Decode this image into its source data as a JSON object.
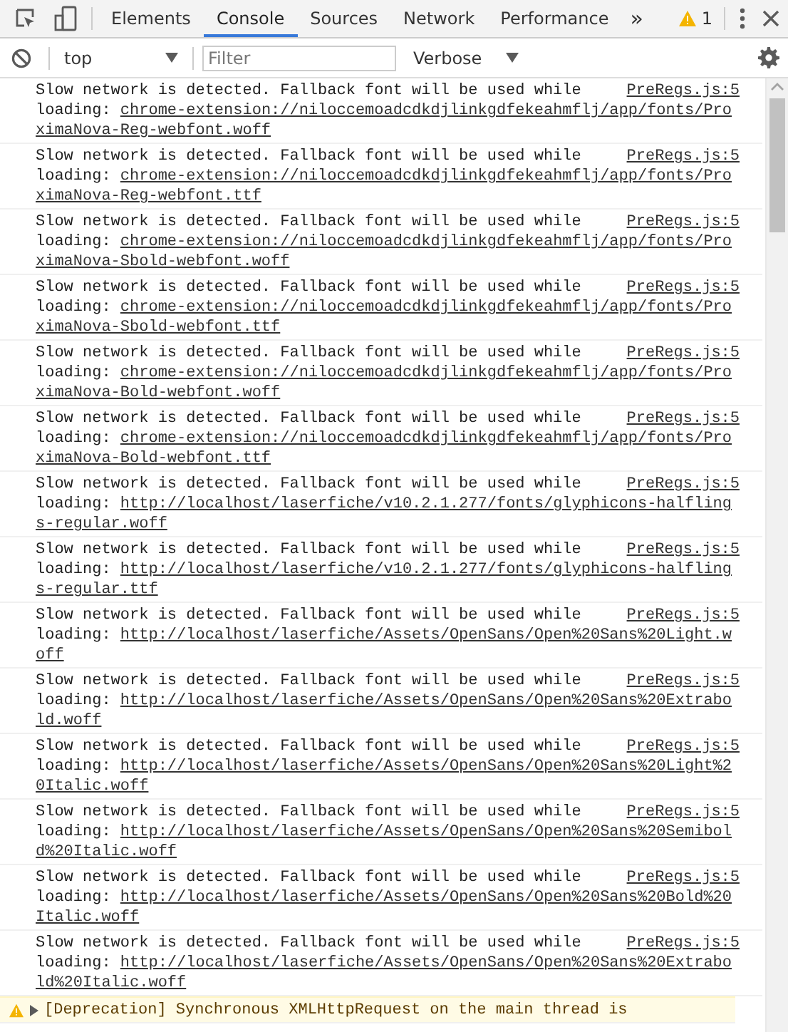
{
  "tabs": [
    {
      "label": "Elements",
      "selected": false
    },
    {
      "label": "Console",
      "selected": true
    },
    {
      "label": "Sources",
      "selected": false
    },
    {
      "label": "Network",
      "selected": false
    },
    {
      "label": "Performance",
      "selected": false
    }
  ],
  "more_tabs": "»",
  "warning_count": "1",
  "toolbar": {
    "context": "top",
    "filter": {
      "placeholder": "Filter"
    },
    "levels": "Verbose"
  },
  "messages": [
    {
      "kind": "log",
      "text": "Slow network is detected. Fallback font will be used while",
      "url_label": "loading:",
      "url": "chrome-extension://niloccemoadcdkdjlinkgdfekeahmflj/app/fonts/ProximaNova-Reg-webfont.woff",
      "source": "PreRegs.js:5"
    },
    {
      "kind": "log",
      "text": "Slow network is detected. Fallback font will be used while",
      "url_label": "loading:",
      "url": "chrome-extension://niloccemoadcdkdjlinkgdfekeahmflj/app/fonts/ProximaNova-Reg-webfont.ttf",
      "source": "PreRegs.js:5"
    },
    {
      "kind": "log",
      "text": "Slow network is detected. Fallback font will be used while",
      "url_label": "loading:",
      "url": "chrome-extension://niloccemoadcdkdjlinkgdfekeahmflj/app/fonts/ProximaNova-Sbold-webfont.woff",
      "source": "PreRegs.js:5"
    },
    {
      "kind": "log",
      "text": "Slow network is detected. Fallback font will be used while",
      "url_label": "loading:",
      "url": "chrome-extension://niloccemoadcdkdjlinkgdfekeahmflj/app/fonts/ProximaNova-Sbold-webfont.ttf",
      "source": "PreRegs.js:5"
    },
    {
      "kind": "log",
      "text": "Slow network is detected. Fallback font will be used while",
      "url_label": "loading:",
      "url": "chrome-extension://niloccemoadcdkdjlinkgdfekeahmflj/app/fonts/ProximaNova-Bold-webfont.woff",
      "source": "PreRegs.js:5"
    },
    {
      "kind": "log",
      "text": "Slow network is detected. Fallback font will be used while",
      "url_label": "loading:",
      "url": "chrome-extension://niloccemoadcdkdjlinkgdfekeahmflj/app/fonts/ProximaNova-Bold-webfont.ttf",
      "source": "PreRegs.js:5"
    },
    {
      "kind": "log",
      "text": "Slow network is detected. Fallback font will be used while",
      "url_label": "loading:",
      "url": "http://localhost/laserfiche/v10.2.1.277/fonts/glyphicons-halflings-regular.woff",
      "source": "PreRegs.js:5"
    },
    {
      "kind": "log",
      "text": "Slow network is detected. Fallback font will be used while",
      "url_label": "loading:",
      "url": "http://localhost/laserfiche/v10.2.1.277/fonts/glyphicons-halflings-regular.ttf",
      "source": "PreRegs.js:5"
    },
    {
      "kind": "log",
      "text": "Slow network is detected. Fallback font will be used while",
      "url_label": "loading:",
      "url": "http://localhost/laserfiche/Assets/OpenSans/Open%20Sans%20Light.woff",
      "source": "PreRegs.js:5"
    },
    {
      "kind": "log",
      "text": "Slow network is detected. Fallback font will be used while",
      "url_label": "loading:",
      "url": "http://localhost/laserfiche/Assets/OpenSans/Open%20Sans%20Extrabold.woff",
      "source": "PreRegs.js:5"
    },
    {
      "kind": "log",
      "text": "Slow network is detected. Fallback font will be used while",
      "url_label": "loading:",
      "url": "http://localhost/laserfiche/Assets/OpenSans/Open%20Sans%20Light%20Italic.woff",
      "source": "PreRegs.js:5"
    },
    {
      "kind": "log",
      "text": "Slow network is detected. Fallback font will be used while",
      "url_label": "loading:",
      "url": "http://localhost/laserfiche/Assets/OpenSans/Open%20Sans%20Semibold%20Italic.woff",
      "source": "PreRegs.js:5"
    },
    {
      "kind": "log",
      "text": "Slow network is detected. Fallback font will be used while",
      "url_label": "loading:",
      "url": "http://localhost/laserfiche/Assets/OpenSans/Open%20Sans%20Bold%20Italic.woff",
      "source": "PreRegs.js:5"
    },
    {
      "kind": "log",
      "text": "Slow network is detected. Fallback font will be used while",
      "url_label": "loading:",
      "url": "http://localhost/laserfiche/Assets/OpenSans/Open%20Sans%20Extrabold%20Italic.woff",
      "source": "PreRegs.js:5"
    },
    {
      "kind": "warning",
      "text": "[Deprecation] Synchronous XMLHttpRequest on the main thread is"
    }
  ]
}
